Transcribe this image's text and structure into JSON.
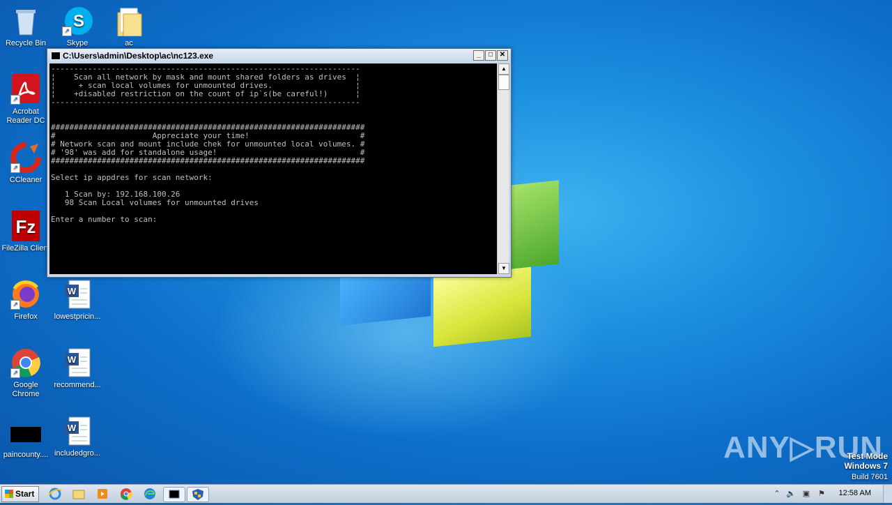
{
  "desktop": {
    "icons": [
      {
        "label": "Recycle Bin"
      },
      {
        "label": "Skype"
      },
      {
        "label": "ac"
      },
      {
        "label": "Acrobat Reader DC"
      },
      {
        "label": "CCleaner"
      },
      {
        "label": "FileZilla Client"
      },
      {
        "label": "Firefox"
      },
      {
        "label": "lowestpricin..."
      },
      {
        "label": "Google Chrome"
      },
      {
        "label": "recommend..."
      },
      {
        "label": "paincounty...."
      },
      {
        "label": "includedgro..."
      }
    ]
  },
  "console": {
    "title": "C:\\Users\\admin\\Desktop\\ac\\nc123.exe",
    "output": "-------------------------------------------------------------------\n¦    Scan all network by mask and mount shared folders as drives  ¦\n¦     + scan local volumes for unmounted drives.                  ¦\n¦    +disabled restriction on the count of ip`s(be careful!)      ¦\n-------------------------------------------------------------------\n\n\n####################################################################\n#                     Appreciate your time!                        #\n# Network scan and mount include chek for unmounted local volumes. #\n# '98' was add for standalone usage!                               #\n####################################################################\n\nSelect ip appdres for scan network:\n\n   1 Scan by: 192.168.100.26\n   98 Scan Local volumes for unmounted drives\n\nEnter a number to scan:",
    "buttons": {
      "minimize": "_",
      "maximize": "□",
      "close": "✕"
    }
  },
  "taskbar": {
    "start_label": "Start",
    "clock": "12:58 AM"
  },
  "watermark": {
    "line1": "Test Mode",
    "line2": "Windows 7",
    "line3": "Build 7601",
    "brand": "ANY▷RUN"
  },
  "colors": {
    "console_bg": "#000000",
    "console_text": "#c0c0c0",
    "desktop_blue": "#1c8fe0"
  }
}
